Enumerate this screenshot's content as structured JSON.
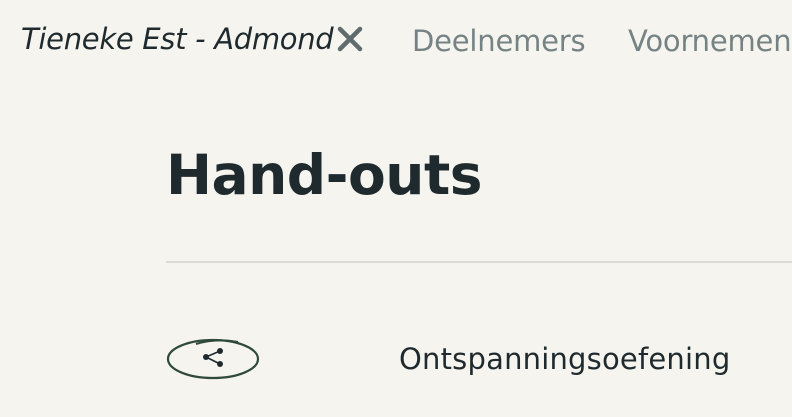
{
  "topnav": {
    "client_name": "Tieneke Est - Admond",
    "close_icon": "close-icon",
    "tabs": [
      {
        "label": "Deelnemers"
      },
      {
        "label": "Voornemens"
      }
    ]
  },
  "page": {
    "title": "Hand-outs"
  },
  "handouts": [
    {
      "share_icon": "share-icon",
      "title": "Ontspanningsoefening"
    }
  ],
  "colors": {
    "background": "#f6f4ef",
    "text": "#1f2a2f",
    "muted_tab": "#768385",
    "accent_green": "#2f4a3b",
    "divider": "#dcdad5"
  }
}
